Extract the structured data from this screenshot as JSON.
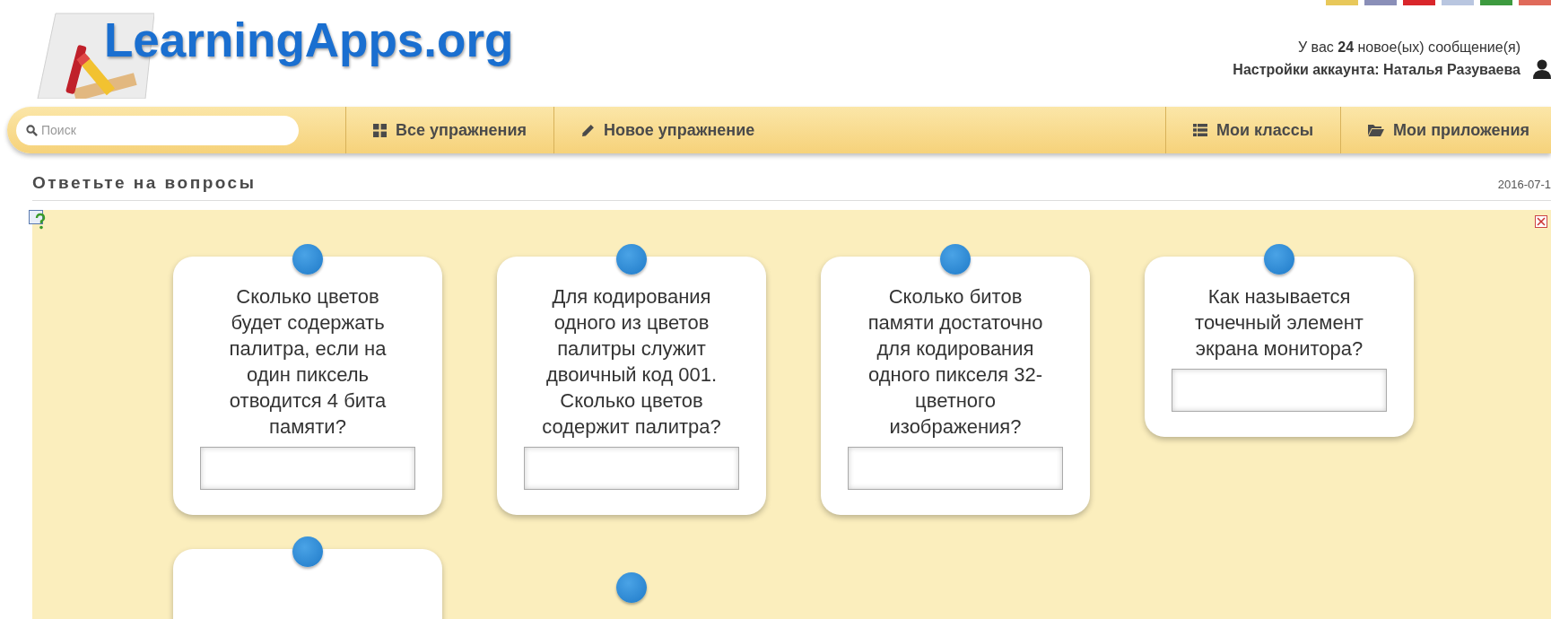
{
  "header": {
    "logo": "LearningApps.org",
    "messages": "У вас **24** новое(ых) сообщение(я)",
    "account": "Настройки аккаунта: Наталья Разуваева"
  },
  "nav": {
    "search": {
      "placeholder": "Поиск"
    },
    "items": [
      {
        "label": "Все упражнения"
      },
      {
        "label": "Новое упражнение"
      },
      {
        "label": "Мои классы"
      },
      {
        "label": "Мои приложения"
      }
    ]
  },
  "page": {
    "title": "Ответьте на вопросы",
    "date": "2016-07-1"
  },
  "cards": [
    {
      "question": "Сколько цветов будет содержать палитра, если на один пиксель отводится 4 бита памяти?"
    },
    {
      "question": "Для кодирования одного из цветов палитры служит двоичный код 001. Сколько цветов содержит палитра?"
    },
    {
      "question": "Сколько битов памяти достаточно для кодирования одного пикселя 32-цветного изображения?"
    },
    {
      "question": "Как называется точечный элемент экрана монитора?"
    }
  ]
}
